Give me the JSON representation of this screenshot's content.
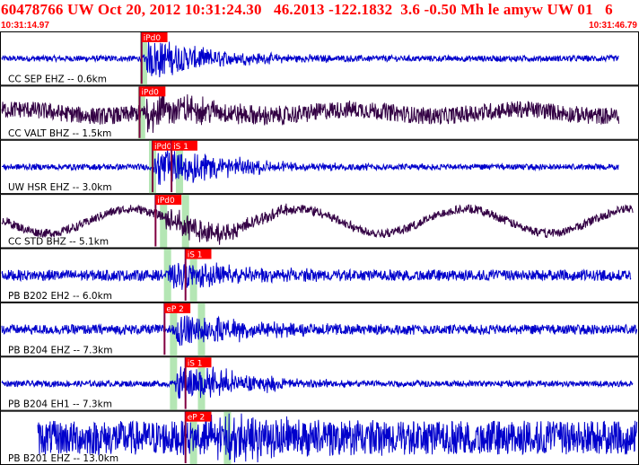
{
  "header": {
    "title": "60478766 UW Oct 20, 2012 10:31:24.30   46.2013 -122.1832  3.6 -0.50 Mh le amyw UW 01   6",
    "time_start": "10:31:14.97",
    "time_end": "10:31:46.79"
  },
  "colors": {
    "header_text": "#ff0000",
    "pick_box": "#ff0000",
    "pick_text": "#ffffff",
    "window_band": "#b4e6b4",
    "pick_line": "#800040"
  },
  "chart_data": {
    "type": "line",
    "time_range": [
      "10:31:14.97",
      "10:31:46.79"
    ],
    "duration_s": 31.82,
    "traces": [
      {
        "label": "CC SEP EHZ -- 0.6km",
        "color": "#0000cc",
        "picks": [
          {
            "label": "iPd0",
            "t": 7.0
          }
        ],
        "p_arrival_s": 7.1,
        "s_arrival_s": null,
        "noise": 0.12,
        "lowfreq": 0.0,
        "amp": 0.95,
        "end_s": 30.9
      },
      {
        "label": "CC VALT BHZ -- 1.5km",
        "color": "#330044",
        "picks": [
          {
            "label": "iPd0",
            "t": 6.9
          }
        ],
        "p_arrival_s": 7.0,
        "s_arrival_s": null,
        "noise": 0.35,
        "lowfreq": 0.15,
        "amp": 0.8,
        "end_s": 30.9
      },
      {
        "label": "UW HSR EHZ -- 3.0km",
        "color": "#0000cc",
        "picks": [
          {
            "label": "iPd0",
            "t": 7.55
          },
          {
            "label": "iS 1",
            "t": 8.5
          }
        ],
        "p_arrival_s": 7.55,
        "s_arrival_s": 8.9,
        "noise": 0.12,
        "lowfreq": 0.0,
        "amp": 0.9,
        "end_s": 30.9
      },
      {
        "label": "CC STD BHZ -- 5.1km",
        "color": "#330044",
        "picks": [
          {
            "label": "iPd0",
            "t": 7.7
          }
        ],
        "p_arrival_s": 8.1,
        "s_arrival_s": 9.2,
        "noise": 0.18,
        "lowfreq": 0.55,
        "amp": 0.6,
        "end_s": 31.6
      },
      {
        "label": "PB B202 EH2 -- 6.0km",
        "color": "#0000cc",
        "picks": [
          {
            "label": "iS 1",
            "t": 9.2
          }
        ],
        "p_arrival_s": 8.3,
        "s_arrival_s": 9.6,
        "noise": 0.22,
        "lowfreq": 0.0,
        "amp": 0.55,
        "end_s": 31.5
      },
      {
        "label": "PB B204 EHZ -- 7.3km",
        "color": "#0000cc",
        "picks": [
          {
            "label": "eP 2",
            "t": 8.15
          }
        ],
        "p_arrival_s": 8.6,
        "s_arrival_s": 10.0,
        "noise": 0.2,
        "lowfreq": 0.0,
        "amp": 0.75,
        "end_s": 31.8
      },
      {
        "label": "PB B204 EH1 -- 7.3km",
        "color": "#0000cc",
        "picks": [
          {
            "label": "iS 1",
            "t": 9.2
          }
        ],
        "p_arrival_s": 8.6,
        "s_arrival_s": 10.0,
        "noise": 0.12,
        "lowfreq": 0.0,
        "amp": 0.8,
        "end_s": 31.6
      },
      {
        "label": "PB B201 EHZ -- 13.0km",
        "color": "#0000cc",
        "picks": [
          {
            "label": "eP 2",
            "t": 9.2
          }
        ],
        "p_arrival_s": 9.6,
        "s_arrival_s": 11.3,
        "noise": 0.7,
        "lowfreq": 0.0,
        "amp": 0.7,
        "start_s": 1.8,
        "end_s": 31.8
      }
    ]
  }
}
